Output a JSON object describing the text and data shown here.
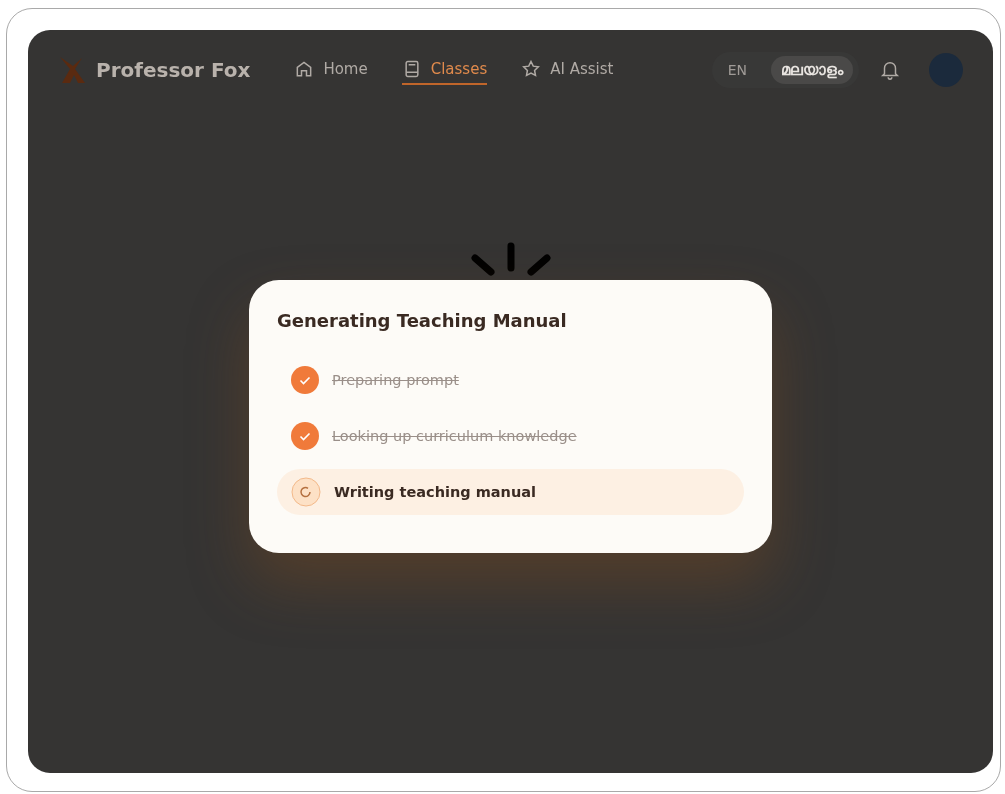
{
  "header": {
    "brand": "Professor Fox",
    "nav": [
      {
        "label": "Home",
        "selected": false
      },
      {
        "label": "Classes",
        "selected": true
      },
      {
        "label": "AI Assist",
        "selected": false
      }
    ],
    "languages": [
      {
        "label": "EN",
        "selected": false
      },
      {
        "label": "മലയാളം",
        "selected": true
      }
    ]
  },
  "dialog": {
    "title": "Generating Teaching Manual",
    "steps": [
      {
        "label": "Preparing prompt",
        "completed": true
      },
      {
        "label": "Looking up curriculum knowledge",
        "completed": true
      },
      {
        "label": "Writing teaching manual",
        "completed": false
      }
    ]
  }
}
